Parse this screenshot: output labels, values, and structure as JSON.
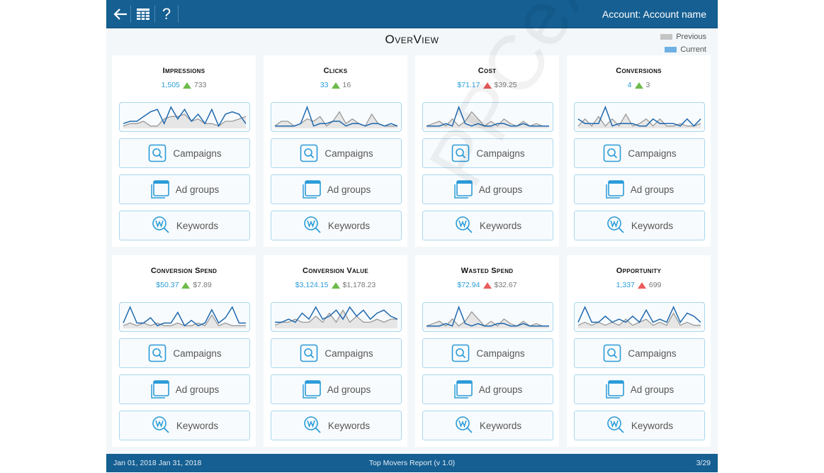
{
  "topbar": {
    "back_icon": "arrow-left-icon",
    "grid_icon": "grid-icon",
    "help_label": "?",
    "account_label": "Account: Account name"
  },
  "page": {
    "title": "OverView",
    "legend": [
      {
        "label": "Previous",
        "color": "#c4c4c4"
      },
      {
        "label": "Current",
        "color": "#6fb1e4"
      }
    ]
  },
  "colors": {
    "header_bg": "#155f92",
    "current": "#2a9bd8",
    "up_good": "#6dbb4b",
    "up_bad": "#ea5b5b",
    "line_current": "#1f68ae",
    "line_previous": "#999999"
  },
  "cards": [
    {
      "title": "Impressions",
      "current": "1,505",
      "previous": "733",
      "trend": "green",
      "spark_current": [
        2,
        3,
        3,
        5,
        7,
        8,
        2,
        9,
        4,
        8,
        3,
        6,
        2,
        8,
        1,
        6,
        7,
        6,
        2
      ],
      "spark_previous": [
        1,
        2,
        2,
        3,
        1,
        1,
        4,
        5,
        5,
        6,
        3,
        4,
        2,
        2,
        1,
        3,
        3,
        4,
        5
      ]
    },
    {
      "title": "Clicks",
      "current": "33",
      "previous": "16",
      "trend": "green",
      "spark_current": [
        1,
        1,
        1,
        1,
        2,
        9,
        1,
        2,
        2,
        3,
        3,
        1,
        2,
        2,
        1,
        2,
        2,
        1,
        2,
        1
      ],
      "spark_previous": [
        1,
        3,
        3,
        1,
        2,
        4,
        3,
        5,
        1,
        3,
        7,
        2,
        4,
        2,
        1,
        6,
        2,
        1,
        1,
        1
      ]
    },
    {
      "title": "Cost",
      "current": "$71.17",
      "previous": "$39.25",
      "trend": "red",
      "spark_current": [
        1,
        1,
        1,
        2,
        1,
        9,
        2,
        1,
        2,
        1,
        1,
        2,
        2,
        1,
        1,
        2,
        1,
        1,
        1,
        1
      ],
      "spark_previous": [
        1,
        2,
        3,
        1,
        4,
        1,
        3,
        7,
        4,
        1,
        3,
        1,
        4,
        2,
        1,
        3,
        1,
        2,
        1,
        1
      ]
    },
    {
      "title": "Conversions",
      "current": "4",
      "previous": "3",
      "trend": "green",
      "spark_current": [
        4,
        2,
        2,
        2,
        9,
        1,
        2,
        2,
        2,
        1,
        1,
        4,
        2,
        2,
        2,
        1,
        4,
        1,
        4
      ],
      "spark_previous": [
        1,
        4,
        1,
        5,
        1,
        4,
        1,
        6,
        1,
        2,
        4,
        1,
        4,
        1,
        1,
        2,
        1,
        1,
        2
      ]
    },
    {
      "title": "Conversion Spend",
      "current": "$50.37",
      "previous": "$7.89",
      "trend": "green",
      "spark_current": [
        2,
        8,
        2,
        2,
        4,
        1,
        2,
        2,
        6,
        1,
        3,
        1,
        2,
        7,
        2,
        4,
        8,
        2,
        2
      ],
      "spark_previous": [
        1,
        2,
        1,
        2,
        1,
        2,
        1,
        1,
        2,
        1,
        1,
        2,
        1,
        5,
        1,
        2,
        1,
        1,
        1
      ]
    },
    {
      "title": "Conversion Value",
      "current": "$3,124.15",
      "previous": "$1,178.23",
      "trend": "green",
      "spark_current": [
        2,
        2,
        3,
        2,
        5,
        3,
        7,
        3,
        4,
        6,
        3,
        7,
        4,
        6,
        3,
        5,
        6,
        4,
        3
      ],
      "spark_previous": [
        1,
        2,
        2,
        3,
        2,
        2,
        4,
        2,
        5,
        2,
        6,
        2,
        4,
        2,
        2,
        3,
        2,
        3,
        3
      ]
    },
    {
      "title": "Wasted Spend",
      "current": "$72.94",
      "previous": "$32.67",
      "trend": "red",
      "spark_current": [
        1,
        1,
        1,
        2,
        1,
        9,
        2,
        1,
        2,
        1,
        1,
        2,
        2,
        1,
        1,
        2,
        1,
        1,
        1,
        1
      ],
      "spark_previous": [
        1,
        2,
        3,
        1,
        4,
        1,
        3,
        7,
        4,
        1,
        3,
        1,
        4,
        2,
        1,
        3,
        1,
        2,
        1,
        1
      ]
    },
    {
      "title": "Opportunity",
      "current": "1,337",
      "previous": "699",
      "trend": "red",
      "spark_current": [
        2,
        7,
        2,
        2,
        4,
        2,
        3,
        2,
        4,
        2,
        6,
        2,
        3,
        2,
        7,
        2,
        5,
        4,
        2
      ],
      "spark_previous": [
        1,
        2,
        1,
        2,
        1,
        2,
        1,
        3,
        1,
        2,
        3,
        1,
        2,
        1,
        5,
        1,
        2,
        1,
        1
      ]
    }
  ],
  "card_buttons": [
    {
      "label": "Campaigns",
      "icon": "magnifier-square-icon"
    },
    {
      "label": "Ad groups",
      "icon": "stacked-windows-icon"
    },
    {
      "label": "Keywords",
      "icon": "keyword-search-icon"
    }
  ],
  "footer": {
    "date_range": "Jan 01, 2018  Jan 31, 2018",
    "report_name": "Top Movers Report (v 1.0)",
    "page": "3/29"
  },
  "watermark": "PPCexpo"
}
